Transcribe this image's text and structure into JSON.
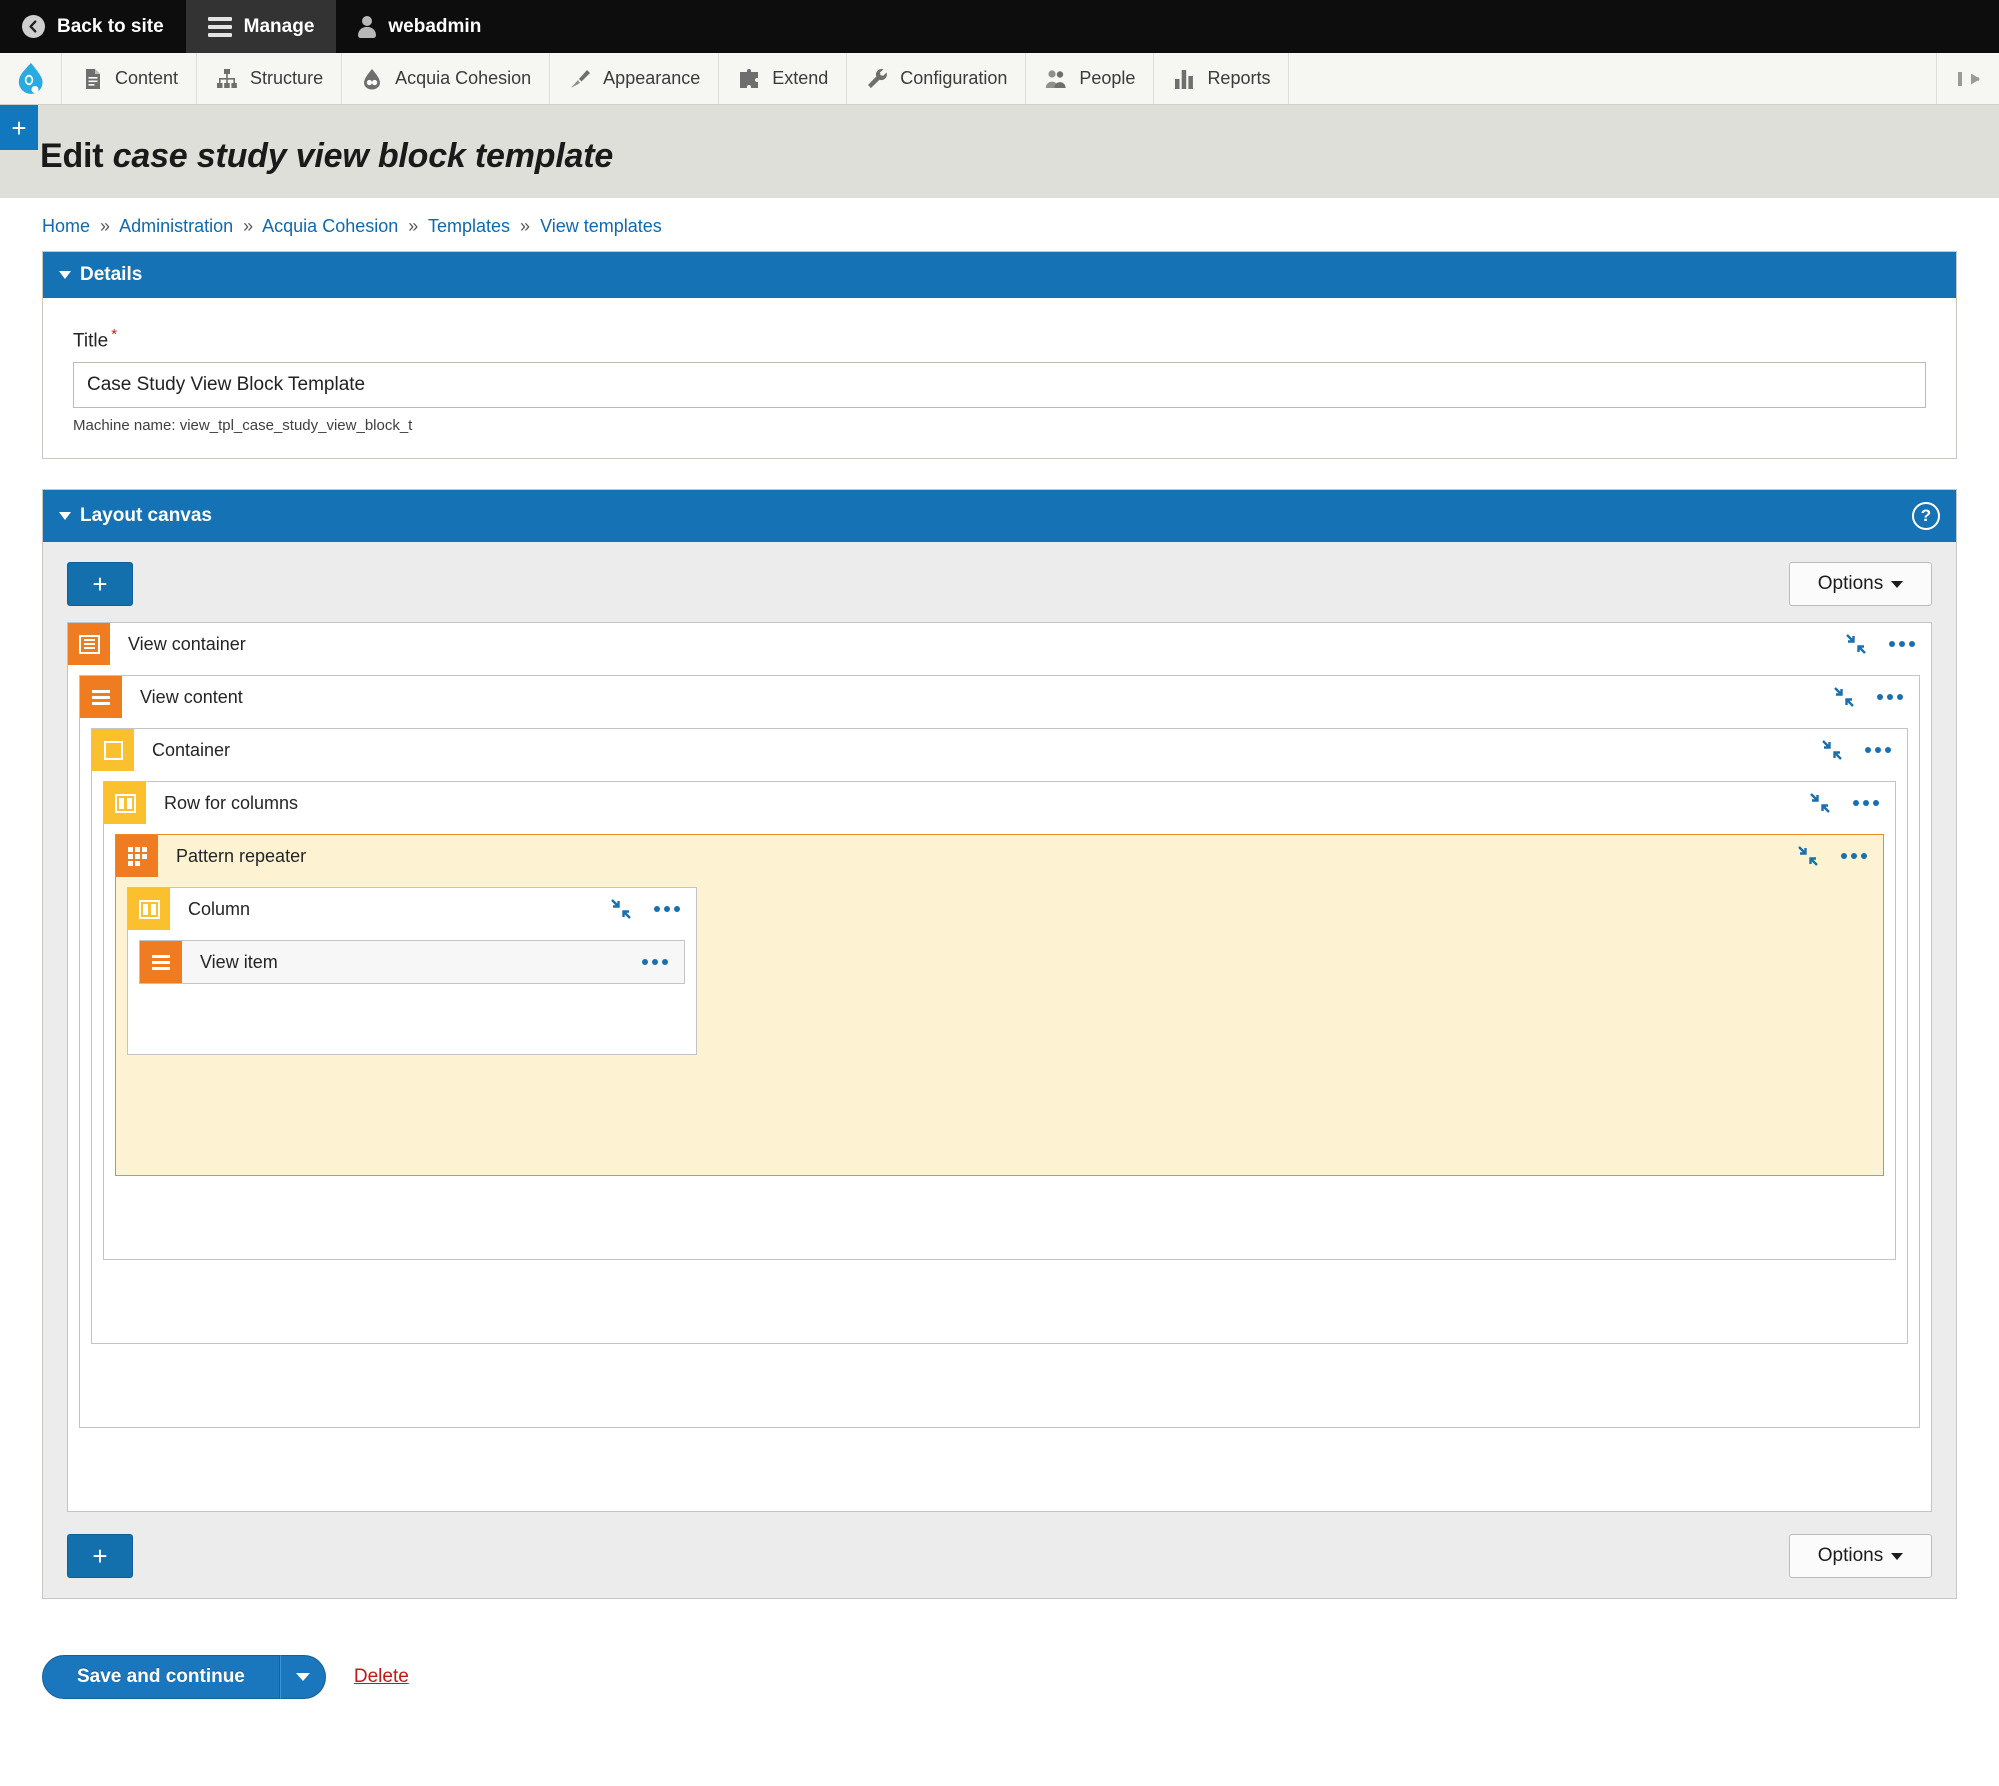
{
  "toolbar": {
    "back_to_site": "Back to site",
    "manage": "Manage",
    "user": "webadmin",
    "back_icon": "back-arrow-icon",
    "menu_icon": "hamburger-icon",
    "user_icon": "person-icon"
  },
  "menu": {
    "logo_icon": "drupal-drop-icon",
    "collapse_icon": "collapse-tray-icon",
    "items": [
      {
        "label": "Content",
        "icon": "content-page-icon"
      },
      {
        "label": "Structure",
        "icon": "structure-tree-icon"
      },
      {
        "label": "Acquia Cohesion",
        "icon": "acquia-cohesion-icon"
      },
      {
        "label": "Appearance",
        "icon": "appearance-brush-icon"
      },
      {
        "label": "Extend",
        "icon": "extend-puzzle-icon"
      },
      {
        "label": "Configuration",
        "icon": "configuration-wrench-icon"
      },
      {
        "label": "People",
        "icon": "people-icon"
      },
      {
        "label": "Reports",
        "icon": "reports-bar-chart-icon"
      }
    ]
  },
  "page": {
    "add_tab_label": "+",
    "title_prefix": "Edit",
    "title_emphasis": "case study view block template"
  },
  "breadcrumb": {
    "separator": "»",
    "items": [
      "Home",
      "Administration",
      "Acquia Cohesion",
      "Templates",
      "View templates"
    ]
  },
  "details": {
    "heading": "Details",
    "title_label": "Title",
    "title_required_mark": "*",
    "title_value": "Case Study View Block Template",
    "title_placeholder": "Title",
    "machine_name": "Machine name: view_tpl_case_study_view_block_t"
  },
  "layout_canvas": {
    "heading": "Layout canvas",
    "help_label": "?",
    "add_label": "+",
    "options_label": "Options",
    "elements": {
      "view_container": {
        "label": "View container",
        "icon": "view-container-icon",
        "tile_color": "#ef7c20"
      },
      "view_content": {
        "label": "View content",
        "icon": "view-content-icon",
        "tile_color": "#ef7c20"
      },
      "container": {
        "label": "Container",
        "icon": "container-square-icon",
        "tile_color": "#fbc02d"
      },
      "row_for_columns": {
        "label": "Row for columns",
        "icon": "row-columns-icon",
        "tile_color": "#fbc02d"
      },
      "pattern_repeater": {
        "label": "Pattern repeater",
        "icon": "pattern-grid-icon",
        "tile_color": "#ef7c20"
      },
      "column": {
        "label": "Column",
        "icon": "column-icon",
        "tile_color": "#fbc02d"
      },
      "view_item": {
        "label": "View item",
        "icon": "view-item-icon",
        "tile_color": "#ef7c20"
      }
    },
    "row_actions": {
      "collapse_icon": "collapse-diagonal-icon",
      "more_icon": "ellipsis-icon"
    }
  },
  "footer_actions": {
    "save_label": "Save and continue",
    "save_caret_icon": "chevron-down-icon",
    "delete_label": "Delete"
  },
  "colors": {
    "accent_blue": "#1572b5",
    "button_blue": "#1470ad",
    "tile_orange": "#ef7c20",
    "tile_yellow": "#fbc02d",
    "highlight_bg": "#fdf2d2",
    "highlight_border": "#ef8a2a",
    "delete_red": "#c41818",
    "required_red": "#e21313"
  }
}
